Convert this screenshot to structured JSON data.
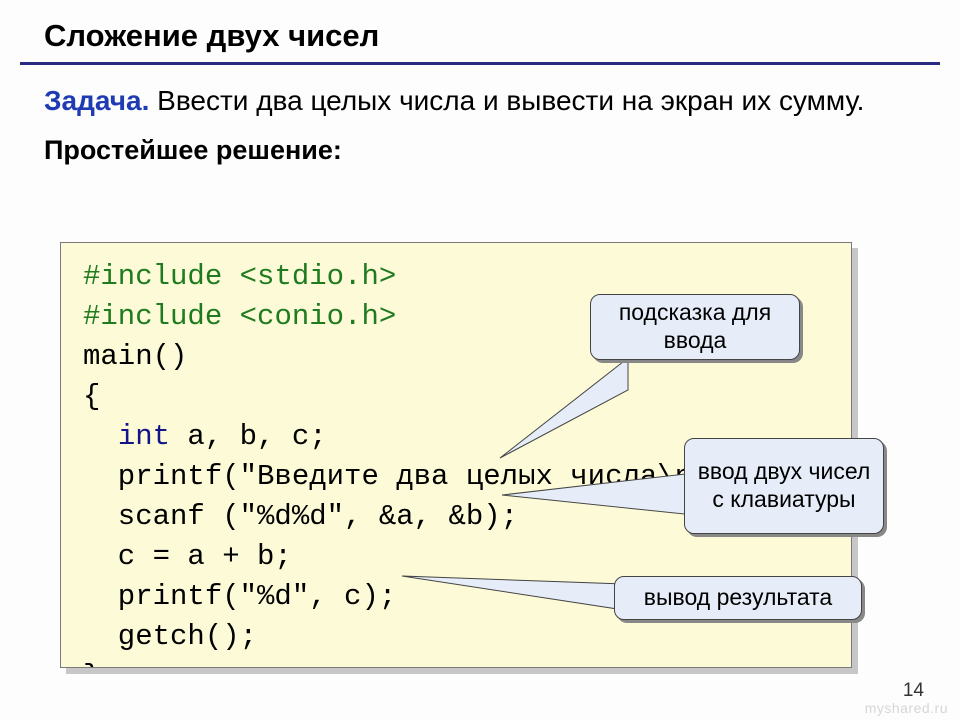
{
  "title": "Сложение двух чисел",
  "task": {
    "label": "Задача.",
    "text": " Ввести два целых числа и вывести на экран их сумму."
  },
  "subhead": "Простейшее решение:",
  "code": {
    "l1a": "#include ",
    "l1b": "<stdio.h>",
    "l2a": "#include ",
    "l2b": "<conio.h>",
    "l3": "main()",
    "l4": "{",
    "l5a": "  ",
    "l5b": "int",
    "l5c": " a, b, c;",
    "l6": "  printf(\"Введите два целых числа\\n\");",
    "l7": "  scanf (\"%d%d\", &a, &b);",
    "l8": "  c = a + b;",
    "l9": "  printf(\"%d\", c);",
    "l10": "  getch();",
    "l11": "}"
  },
  "callouts": {
    "c1": "подсказка для ввода",
    "c2": "ввод двух чисел с клавиатуры",
    "c3": "вывод результата"
  },
  "pagenum": "14",
  "watermark": "myshared.ru"
}
